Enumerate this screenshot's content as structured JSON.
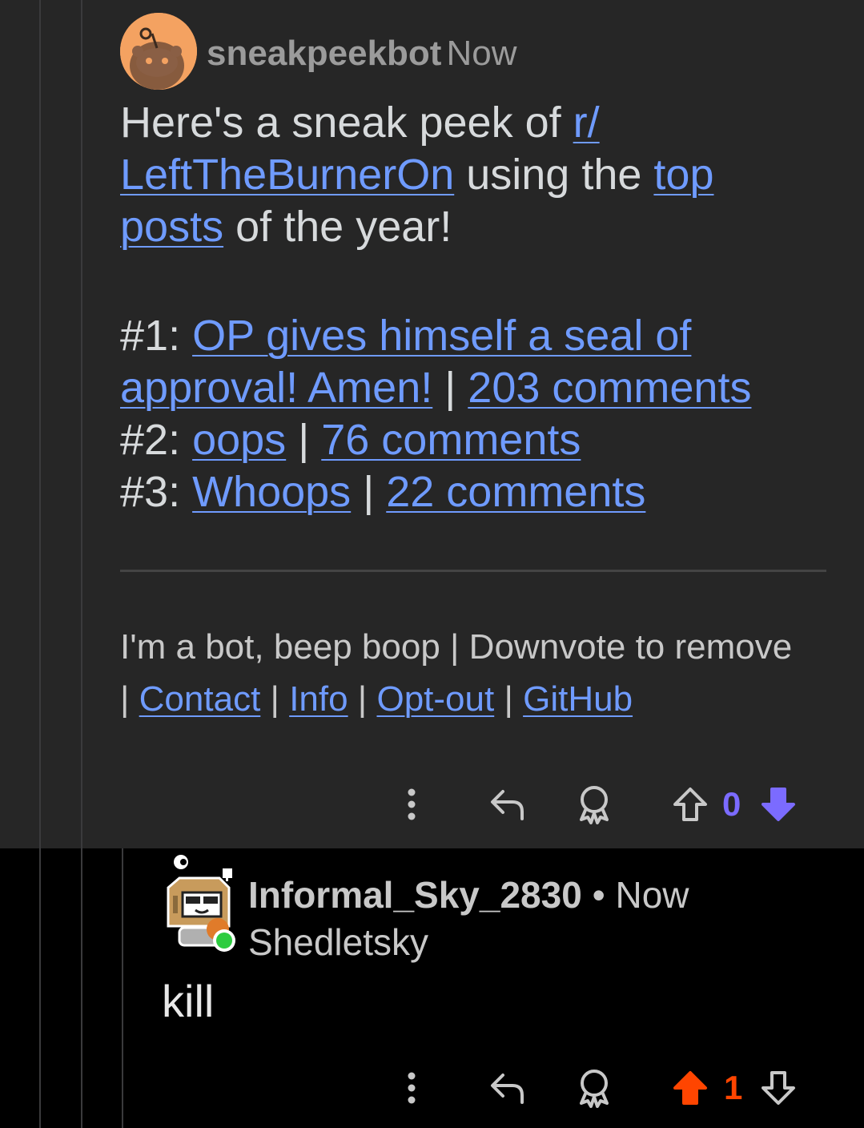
{
  "bot_comment": {
    "username": "sneakpeekbot",
    "time": "Now",
    "intro": {
      "text1": "Here's a sneak peek of ",
      "subreddit_part1": "r/",
      "subreddit_part2": "LeftTheBurnerOn",
      "text2": " using the ",
      "top_posts_part1": "top",
      "top_posts_part2": "posts",
      "text3": " of the year!"
    },
    "posts": [
      {
        "rank": "#1: ",
        "title_part1": "OP gives himself a seal of",
        "title_part2": "approval! Amen!",
        "separator": " | ",
        "comments": "203 comments"
      },
      {
        "rank": "#2: ",
        "title": "oops",
        "separator": " | ",
        "comments": "76 comments"
      },
      {
        "rank": "#3: ",
        "title": "Whoops",
        "separator": " | ",
        "comments": "22 comments"
      }
    ],
    "footer": {
      "text": "I'm a bot, beep boop | Downvote to remove",
      "sep": "| ",
      "sep_between": " | ",
      "links": [
        "Contact",
        "Info",
        "Opt-out",
        "GitHub"
      ]
    },
    "score": "0",
    "vote_state": "downvoted"
  },
  "reply": {
    "username": "Informal_Sky_2830",
    "separator": " • ",
    "time": "Now",
    "flair": "Shedletsky",
    "body": "kill",
    "score": "1",
    "vote_state": "upvoted"
  },
  "colors": {
    "link": "#6f9bff",
    "downvote": "#7b6bff",
    "upvote": "#ff4500",
    "online": "#2ecc40"
  }
}
